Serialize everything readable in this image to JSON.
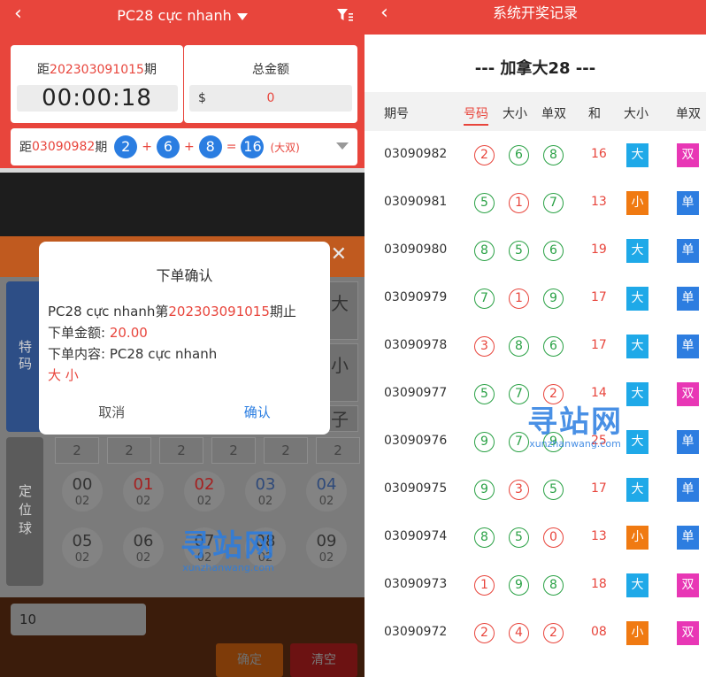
{
  "left": {
    "header": {
      "title": "PC28 cực nhanh"
    },
    "countdown": {
      "prefix": "距",
      "period": "202303091015",
      "suffix": "期",
      "timer": "00:00:18"
    },
    "amount": {
      "label": "总金额",
      "currency": "$",
      "value": "0"
    },
    "last_draw": {
      "prefix": "距",
      "period": "03090982",
      "suffix": "期",
      "n1": "2",
      "n2": "6",
      "n3": "8",
      "sum": "16",
      "result": "(大双)"
    },
    "sidebar": {
      "tab_special": "特码",
      "tab_position": "定位球"
    },
    "bet_labels": {
      "b1": "大",
      "b2": "小",
      "b3": "子"
    },
    "counts": [
      "2",
      "2",
      "2",
      "2",
      "2",
      "2"
    ],
    "balls": [
      {
        "n": "00",
        "s": "02"
      },
      {
        "n": "01",
        "s": "02"
      },
      {
        "n": "02",
        "s": "02"
      },
      {
        "n": "03",
        "s": "02"
      },
      {
        "n": "04",
        "s": "02"
      },
      {
        "n": "05",
        "s": "02"
      },
      {
        "n": "06",
        "s": "02"
      },
      {
        "n": "07",
        "s": "02"
      },
      {
        "n": "08",
        "s": "02"
      },
      {
        "n": "09",
        "s": "02"
      }
    ],
    "quantity": "10",
    "confirm_btn": "确定",
    "clear_btn": "清空",
    "modal": {
      "title": "下单确认",
      "line1_a": "PC28 cực nhanh第",
      "line1_period": "202303091015",
      "line1_b": "期止",
      "amount_label": "下单金额:",
      "amount_value": "20.00",
      "content_label": "下单内容:",
      "content_value": "PC28 cực nhanh",
      "selection": "大 小",
      "cancel": "取消",
      "confirm": "确认"
    }
  },
  "right": {
    "header": {
      "title": "系统开奖记录"
    },
    "game_title": "--- 加拿大28 ---",
    "columns": [
      "期号",
      "号码",
      "大小",
      "单双",
      "和",
      "大小",
      "单双"
    ],
    "rows": [
      {
        "period": "03090982",
        "balls": [
          "2",
          "6",
          "8"
        ],
        "colors": [
          "red",
          "green",
          "green"
        ],
        "sum": "16",
        "size": "大",
        "parity": "双"
      },
      {
        "period": "03090981",
        "balls": [
          "5",
          "1",
          "7"
        ],
        "colors": [
          "green",
          "red",
          "green"
        ],
        "sum": "13",
        "size": "小",
        "parity": "单"
      },
      {
        "period": "03090980",
        "balls": [
          "8",
          "5",
          "6"
        ],
        "colors": [
          "green",
          "green",
          "green"
        ],
        "sum": "19",
        "size": "大",
        "parity": "单"
      },
      {
        "period": "03090979",
        "balls": [
          "7",
          "1",
          "9"
        ],
        "colors": [
          "green",
          "red",
          "green"
        ],
        "sum": "17",
        "size": "大",
        "parity": "单"
      },
      {
        "period": "03090978",
        "balls": [
          "3",
          "8",
          "6"
        ],
        "colors": [
          "red",
          "green",
          "green"
        ],
        "sum": "17",
        "size": "大",
        "parity": "单"
      },
      {
        "period": "03090977",
        "balls": [
          "5",
          "7",
          "2"
        ],
        "colors": [
          "green",
          "green",
          "red"
        ],
        "sum": "14",
        "size": "大",
        "parity": "双"
      },
      {
        "period": "03090976",
        "balls": [
          "9",
          "7",
          "9"
        ],
        "colors": [
          "green",
          "green",
          "green"
        ],
        "sum": "25",
        "size": "大",
        "parity": "单"
      },
      {
        "period": "03090975",
        "balls": [
          "9",
          "3",
          "5"
        ],
        "colors": [
          "green",
          "red",
          "green"
        ],
        "sum": "17",
        "size": "大",
        "parity": "单"
      },
      {
        "period": "03090974",
        "balls": [
          "8",
          "5",
          "0"
        ],
        "colors": [
          "green",
          "green",
          "red"
        ],
        "sum": "13",
        "size": "小",
        "parity": "单"
      },
      {
        "period": "03090973",
        "balls": [
          "1",
          "9",
          "8"
        ],
        "colors": [
          "red",
          "green",
          "green"
        ],
        "sum": "18",
        "size": "大",
        "parity": "双"
      },
      {
        "period": "03090972",
        "balls": [
          "2",
          "4",
          "2"
        ],
        "colors": [
          "red",
          "red",
          "red"
        ],
        "sum": "08",
        "size": "小",
        "parity": "双"
      }
    ]
  },
  "watermark": {
    "text": "寻站网",
    "sub": "xunzhanwang.com"
  },
  "colors": {
    "primary_red": "#e8453c",
    "blue": "#2a7de1",
    "green": "#2aa145",
    "tag_big": "#1fa9e8",
    "tag_small": "#f07a12",
    "tag_odd": "#2d7de0",
    "tag_even": "#e837b5"
  }
}
